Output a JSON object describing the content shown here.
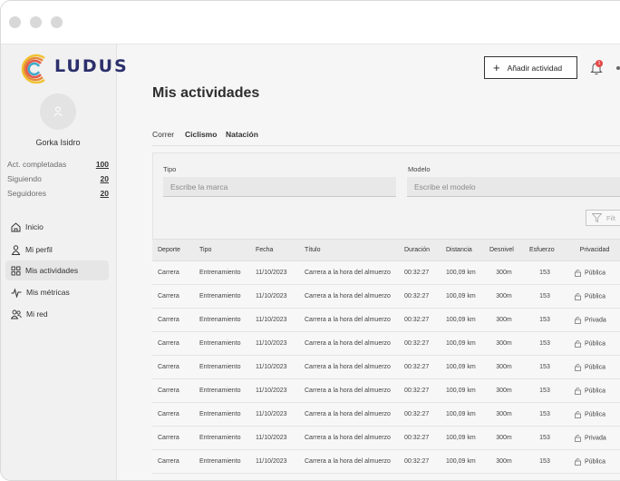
{
  "brand": {
    "name": "LUDUS"
  },
  "user": {
    "name": "Gorka Isidro",
    "stats": [
      {
        "label": "Act. completadas",
        "value": "100"
      },
      {
        "label": "Siguiendo",
        "value": "20"
      },
      {
        "label": "Seguidores",
        "value": "20"
      }
    ]
  },
  "nav": [
    {
      "label": "Inicio",
      "icon": "home-icon",
      "active": false
    },
    {
      "label": "Mi perfil",
      "icon": "user-icon",
      "active": false
    },
    {
      "label": "Mis actividades",
      "icon": "grid-icon",
      "active": true
    },
    {
      "label": "Mis métricas",
      "icon": "pulse-icon",
      "active": false
    },
    {
      "label": "Mi red",
      "icon": "users-icon",
      "active": false
    }
  ],
  "header": {
    "add_button": "Añadir actividad",
    "notification_count": "1"
  },
  "page": {
    "title": "Mis actividades"
  },
  "tabs": [
    "Correr",
    "Ciclismo",
    "Natación"
  ],
  "filters": {
    "tipo_label": "Tipo",
    "tipo_placeholder": "Escribe la marca",
    "modelo_label": "Modelo",
    "modelo_placeholder": "Escribe el modelo",
    "filter_button": "Filt"
  },
  "table": {
    "columns": [
      "Deporte",
      "Tipo",
      "Fecha",
      "Título",
      "Duración",
      "Distancia",
      "Desnivel",
      "Esfuerzo",
      "Privacidad"
    ],
    "rows": [
      [
        "Carrera",
        "Entrenamiento",
        "11/10/2023",
        "Carrera a la hora del almuerzo",
        "00:32:27",
        "100,09 km",
        "300m",
        "153",
        "Pública"
      ],
      [
        "Carrera",
        "Entrenamiento",
        "11/10/2023",
        "Carrera a la hora del almuerzo",
        "00:32:27",
        "100,09 km",
        "300m",
        "153",
        "Pública"
      ],
      [
        "Carrera",
        "Entrenamiento",
        "11/10/2023",
        "Carrera a la hora del almuerzo",
        "00:32:27",
        "100,09 km",
        "300m",
        "153",
        "Privada"
      ],
      [
        "Carrera",
        "Entrenamiento",
        "11/10/2023",
        "Carrera a la hora del almuerzo",
        "00:32:27",
        "100,09 km",
        "300m",
        "153",
        "Pública"
      ],
      [
        "Carrera",
        "Entrenamiento",
        "11/10/2023",
        "Carrera a la hora del almuerzo",
        "00:32:27",
        "100,09 km",
        "300m",
        "153",
        "Pública"
      ],
      [
        "Carrera",
        "Entrenamiento",
        "11/10/2023",
        "Carrera a la hora del almuerzo",
        "00:32:27",
        "100,09 km",
        "300m",
        "153",
        "Pública"
      ],
      [
        "Carrera",
        "Entrenamiento",
        "11/10/2023",
        "Carrera a la hora del almuerzo",
        "00:32:27",
        "100,09 km",
        "300m",
        "153",
        "Pública"
      ],
      [
        "Carrera",
        "Entrenamiento",
        "11/10/2023",
        "Carrera a la hora del almuerzo",
        "00:32:27",
        "100,09 km",
        "300m",
        "153",
        "Privada"
      ],
      [
        "Carrera",
        "Entrenamiento",
        "11/10/2023",
        "Carrera a la hora del almuerzo",
        "00:32:27",
        "100,09 km",
        "300m",
        "153",
        "Pública"
      ]
    ]
  },
  "colors": {
    "accent": "#2b2f6b",
    "badge": "#e54848"
  }
}
